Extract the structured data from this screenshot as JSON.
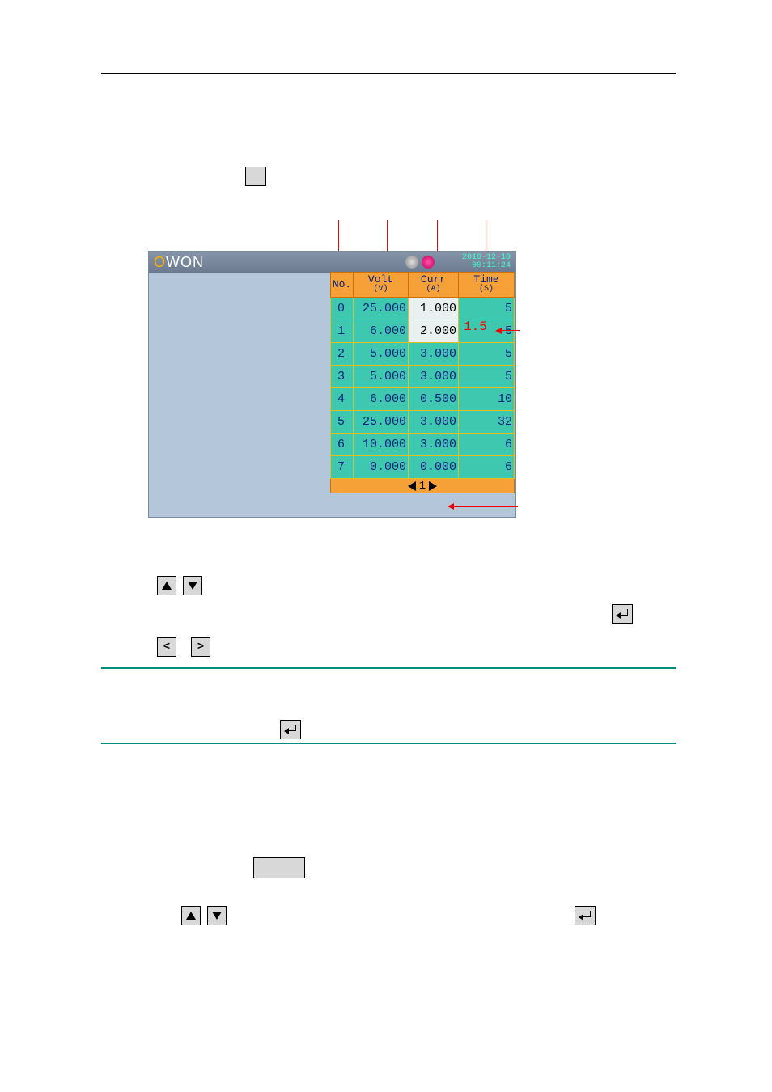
{
  "titlebar": {
    "logo_o": "O",
    "logo_rest": "WON",
    "date": "2010-12-10",
    "time": "00:11:24"
  },
  "headers": {
    "no": "No.",
    "volt": "Volt",
    "volt_unit": "(V)",
    "curr": "Curr",
    "curr_unit": "(A)",
    "time": "Time",
    "time_unit": "(S)"
  },
  "rows": [
    {
      "no": "0",
      "v": "25.000",
      "c": "1.000",
      "t": "5",
      "hl_c": true
    },
    {
      "no": "1",
      "v": "6.000",
      "c": "2.000",
      "t": "5",
      "hl_c": true
    },
    {
      "no": "2",
      "v": "5.000",
      "c": "3.000",
      "t": "5"
    },
    {
      "no": "3",
      "v": "5.000",
      "c": "3.000",
      "t": "5"
    },
    {
      "no": "4",
      "v": "6.000",
      "c": "0.500",
      "t": "10"
    },
    {
      "no": "5",
      "v": "25.000",
      "c": "3.000",
      "t": "32"
    },
    {
      "no": "6",
      "v": "10.000",
      "c": "3.000",
      "t": "6"
    },
    {
      "no": "7",
      "v": "0.000",
      "c": "0.000",
      "t": "6"
    }
  ],
  "pager": {
    "page": "1"
  },
  "annotation": {
    "val": "1.5"
  },
  "glyphs": {
    "lt": "<",
    "gt": ">"
  }
}
